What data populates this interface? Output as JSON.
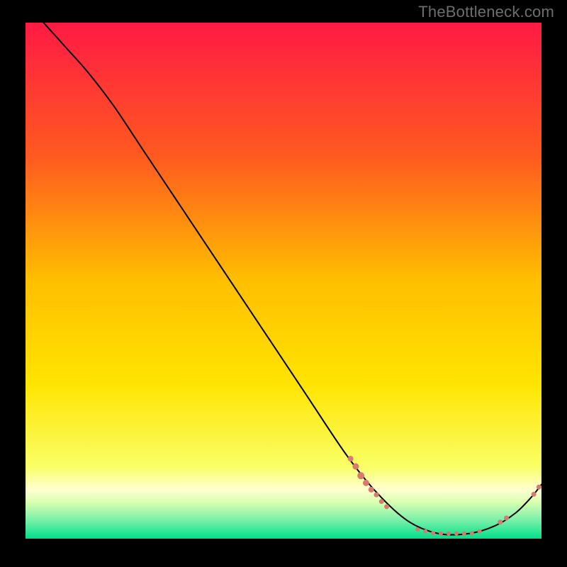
{
  "attribution": "TheBottleneck.com",
  "chart_data": {
    "type": "line",
    "title": "",
    "xlabel": "",
    "ylabel": "",
    "xlim": [
      0,
      100
    ],
    "ylim": [
      0,
      100
    ],
    "background_gradient": {
      "top_color": "#ff1a44",
      "mid_top_color": "#ff8a1a",
      "mid_color": "#ffe400",
      "mid_bottom_color": "#f9ff66",
      "green_band_top": "#d8ffb0",
      "green_band_bottom": "#00e08a"
    },
    "curve": [
      {
        "x": 3.5,
        "y": 100.0
      },
      {
        "x": 8.0,
        "y": 95.0
      },
      {
        "x": 12.0,
        "y": 90.5
      },
      {
        "x": 17.0,
        "y": 84.0
      },
      {
        "x": 23.0,
        "y": 75.0
      },
      {
        "x": 30.0,
        "y": 64.5
      },
      {
        "x": 38.0,
        "y": 52.5
      },
      {
        "x": 46.0,
        "y": 40.5
      },
      {
        "x": 54.0,
        "y": 28.5
      },
      {
        "x": 62.0,
        "y": 16.5
      },
      {
        "x": 68.0,
        "y": 9.0
      },
      {
        "x": 74.0,
        "y": 3.5
      },
      {
        "x": 80.0,
        "y": 1.0
      },
      {
        "x": 86.0,
        "y": 1.0
      },
      {
        "x": 91.0,
        "y": 2.5
      },
      {
        "x": 95.0,
        "y": 5.0
      },
      {
        "x": 98.0,
        "y": 8.0
      },
      {
        "x": 100.0,
        "y": 10.5
      }
    ],
    "highlight_points": [
      {
        "x": 63.0,
        "y": 15.5,
        "r": 4.0
      },
      {
        "x": 64.0,
        "y": 14.0,
        "r": 4.5
      },
      {
        "x": 65.0,
        "y": 12.2,
        "r": 5.0
      },
      {
        "x": 66.0,
        "y": 10.8,
        "r": 4.5
      },
      {
        "x": 67.0,
        "y": 9.5,
        "r": 4.0
      },
      {
        "x": 68.0,
        "y": 8.5,
        "r": 3.5
      },
      {
        "x": 69.0,
        "y": 7.2,
        "r": 3.5
      },
      {
        "x": 70.0,
        "y": 6.2,
        "r": 3.5
      },
      {
        "x": 76.0,
        "y": 1.8,
        "r": 3.0
      },
      {
        "x": 77.5,
        "y": 1.4,
        "r": 3.0
      },
      {
        "x": 79.0,
        "y": 1.1,
        "r": 3.0
      },
      {
        "x": 80.5,
        "y": 1.0,
        "r": 3.0
      },
      {
        "x": 82.0,
        "y": 1.0,
        "r": 3.0
      },
      {
        "x": 83.5,
        "y": 1.0,
        "r": 3.0
      },
      {
        "x": 85.0,
        "y": 1.0,
        "r": 3.0
      },
      {
        "x": 86.5,
        "y": 1.1,
        "r": 3.0
      },
      {
        "x": 88.0,
        "y": 1.4,
        "r": 3.0
      },
      {
        "x": 92.0,
        "y": 3.2,
        "r": 3.5
      },
      {
        "x": 93.2,
        "y": 4.0,
        "r": 3.5
      },
      {
        "x": 98.5,
        "y": 8.6,
        "r": 3.5
      },
      {
        "x": 99.5,
        "y": 10.0,
        "r": 3.5
      }
    ],
    "highlight_color": "#d87a6f",
    "curve_color": "#000000"
  }
}
